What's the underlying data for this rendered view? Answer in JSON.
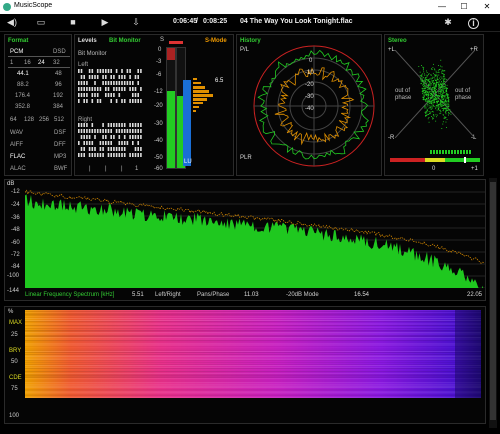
{
  "window": {
    "title": "MusicScope",
    "minimize": "—",
    "maximize": "☐",
    "close": "✕"
  },
  "toolbar": {
    "volume_icon": "◀)",
    "folder_icon": "▭",
    "stop_icon": "■",
    "play_icon": "▶",
    "export_icon": "⇩",
    "elapsed": "0:06:45",
    "separator": "/",
    "total": "0:08:25",
    "track": "04 The Way You Look Tonight.flac",
    "settings_icon": "✱",
    "info_icon": "i"
  },
  "format": {
    "title": "Format",
    "col1": [
      "PCM",
      "1",
      "44.1",
      "88.2",
      "176.4",
      "352.8",
      "64",
      "WAV",
      "AIFF",
      "FLAC",
      "ALAC"
    ],
    "col2": [
      "DSD",
      "8",
      "16",
      "24",
      "32",
      "48",
      "96",
      "192",
      "384",
      "128",
      "256",
      "512",
      "DSF",
      "DFF",
      "MP3",
      "WAV"
    ],
    "bits": [
      "1",
      "16",
      "24",
      "32"
    ],
    "rates_left": [
      "44.1",
      "88.2",
      "176.4",
      "352.8"
    ],
    "rates_right": [
      "48",
      "96",
      "192",
      "384"
    ],
    "dsd_row": [
      "64",
      "128",
      "256",
      "512"
    ],
    "files_left": [
      "WAV",
      "AIFF",
      "FLAC",
      "ALAC"
    ],
    "files_right": [
      "DSF",
      "DFF",
      "MP3",
      "BWF"
    ]
  },
  "levels": {
    "title": "Levels",
    "mode": "Bit Monitor",
    "sub": "Bit Monitor",
    "left": "Left",
    "right": "Right",
    "marks": [
      "|",
      "|",
      "|",
      "1"
    ],
    "db_ticks": [
      "0",
      "-3",
      "-6",
      "-12",
      "-20",
      "-30",
      "-40",
      "-50",
      "-60"
    ],
    "s_label": "S",
    "smode": "S-Mode",
    "peak": "6.5",
    "lu": "LU",
    "m_label": "M"
  },
  "history": {
    "title": "History",
    "pl": "P/L",
    "plr": "PLR",
    "rings": [
      "0",
      "-10",
      "-20",
      "-30",
      "-40"
    ]
  },
  "stereo": {
    "title": "Stereo",
    "plus_l": "+L",
    "plus_r": "+R",
    "minus_l": "-R",
    "minus_r": "-L",
    "out_left": "out of phase",
    "out_right": "out of phase",
    "corr_zero": "0",
    "corr_plus": "+1"
  },
  "spectrum": {
    "db_unit": "dB",
    "db_ticks": [
      "-12",
      "-24",
      "-36",
      "-48",
      "-60",
      "-72",
      "-84",
      "-100",
      "-144"
    ],
    "title": "Linear Frequency Spectrum [kHz]",
    "x_ticks": [
      "5.51",
      "11.03",
      "16.54",
      "22.05"
    ],
    "mode1": "Left/Right",
    "mode2": "Pans/Phase",
    "mode3": "-20dB Mode"
  },
  "spectrogram": {
    "percent": "%",
    "labels": [
      "MAX",
      "25",
      "BRY",
      "50",
      "CDE",
      "75",
      "100"
    ]
  },
  "colors": {
    "green": "#22cc22",
    "orange": "#e09000",
    "red": "#dd3333",
    "bg": "#000000"
  }
}
